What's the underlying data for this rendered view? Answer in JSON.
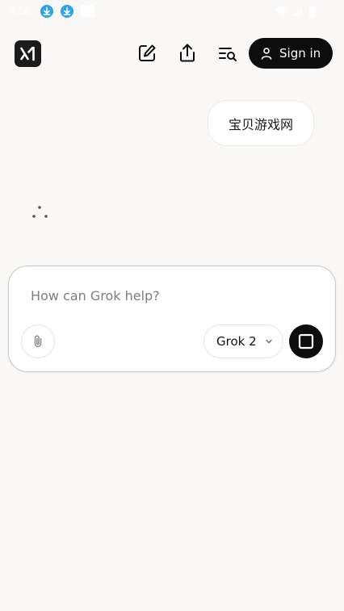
{
  "status_bar": {
    "time": "9:56",
    "icons": [
      "download-icon",
      "download-icon",
      "notification-square-icon",
      "wifi-icon",
      "signal-icon",
      "battery-icon"
    ]
  },
  "header": {
    "logo_icon": "grok-xai-logo",
    "new_chat_icon": "edit-icon",
    "share_icon": "share-icon",
    "history_icon": "search-history-icon",
    "sign_in_label": "Sign in",
    "sign_in_icon": "user-icon"
  },
  "chat": {
    "user_message": "宝贝游戏网",
    "assistant_state_icon": "loading-dots-icon"
  },
  "composer": {
    "placeholder": "How can Grok help?",
    "value": "",
    "attach_icon": "paperclip-icon",
    "model_selected": "Grok 2",
    "model_chevron_icon": "chevron-down-icon",
    "stop_icon": "stop-square-icon"
  },
  "colors": {
    "background": "#f9f8f6",
    "accent_dark": "#0d0d0d",
    "status_download": "#2aa3f2"
  }
}
